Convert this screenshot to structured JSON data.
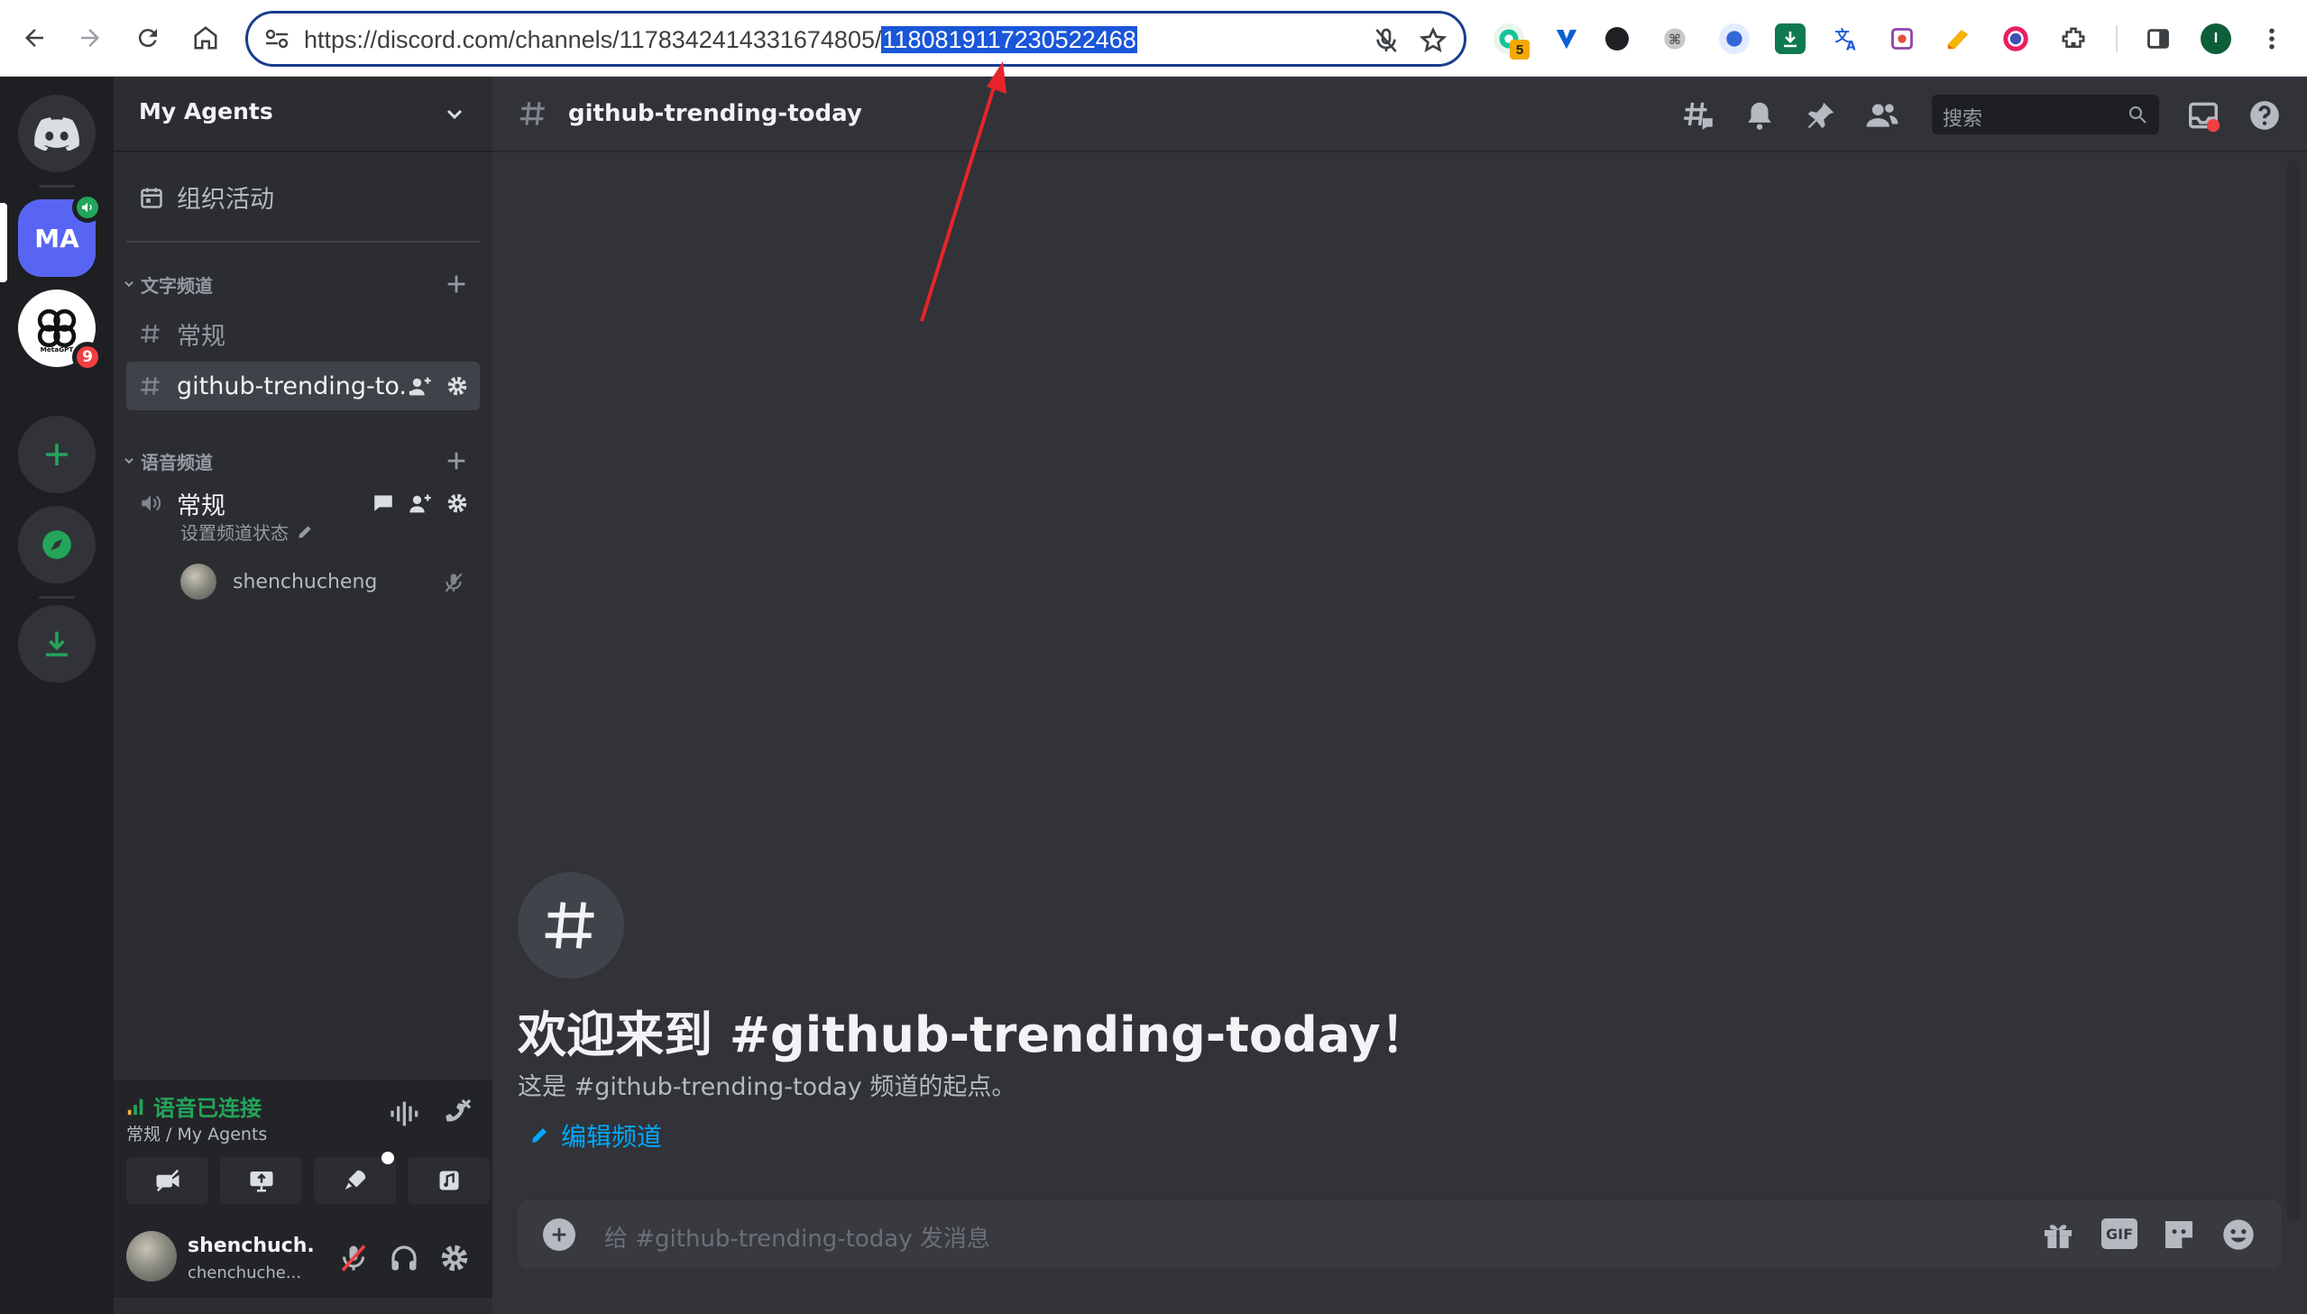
{
  "browser": {
    "url_prefix": "https://discord.com/channels/1178342414331674805/",
    "url_selected": "1180819117230522468",
    "ext_badge": "5",
    "profile_initial": "I"
  },
  "servers": {
    "home_label": "Discord",
    "active_initials": "MA",
    "second_badge": "9",
    "second_name": "MetaGPT"
  },
  "sidebar": {
    "guild_name": "My Agents",
    "events_label": "组织活动",
    "text_category": "文字频道",
    "text_channels": [
      "常规",
      "github-trending-to..."
    ],
    "voice_category": "语音频道",
    "voice_channel": "常规",
    "voice_status": "设置频道状态",
    "voice_user": "shenchucheng"
  },
  "voice_panel": {
    "status": "语音已连接",
    "location": "常规 / My Agents"
  },
  "user_area": {
    "name": "shenchuch...",
    "tag": "chenchuche..."
  },
  "main": {
    "channel_name": "github-trending-today",
    "search_placeholder": "搜索",
    "welcome_title": "欢迎来到 #github-trending-today！",
    "welcome_sub": "这是 #github-trending-today 频道的起点。",
    "edit_channel": "编辑频道",
    "composer_placeholder": "给 #github-trending-today 发消息",
    "gif_label": "GIF"
  },
  "colors": {
    "blurple": "#5865f2",
    "green": "#23a55a",
    "red": "#f23f43",
    "link": "#00a8fc",
    "annotation_arrow": "#e8242b"
  }
}
